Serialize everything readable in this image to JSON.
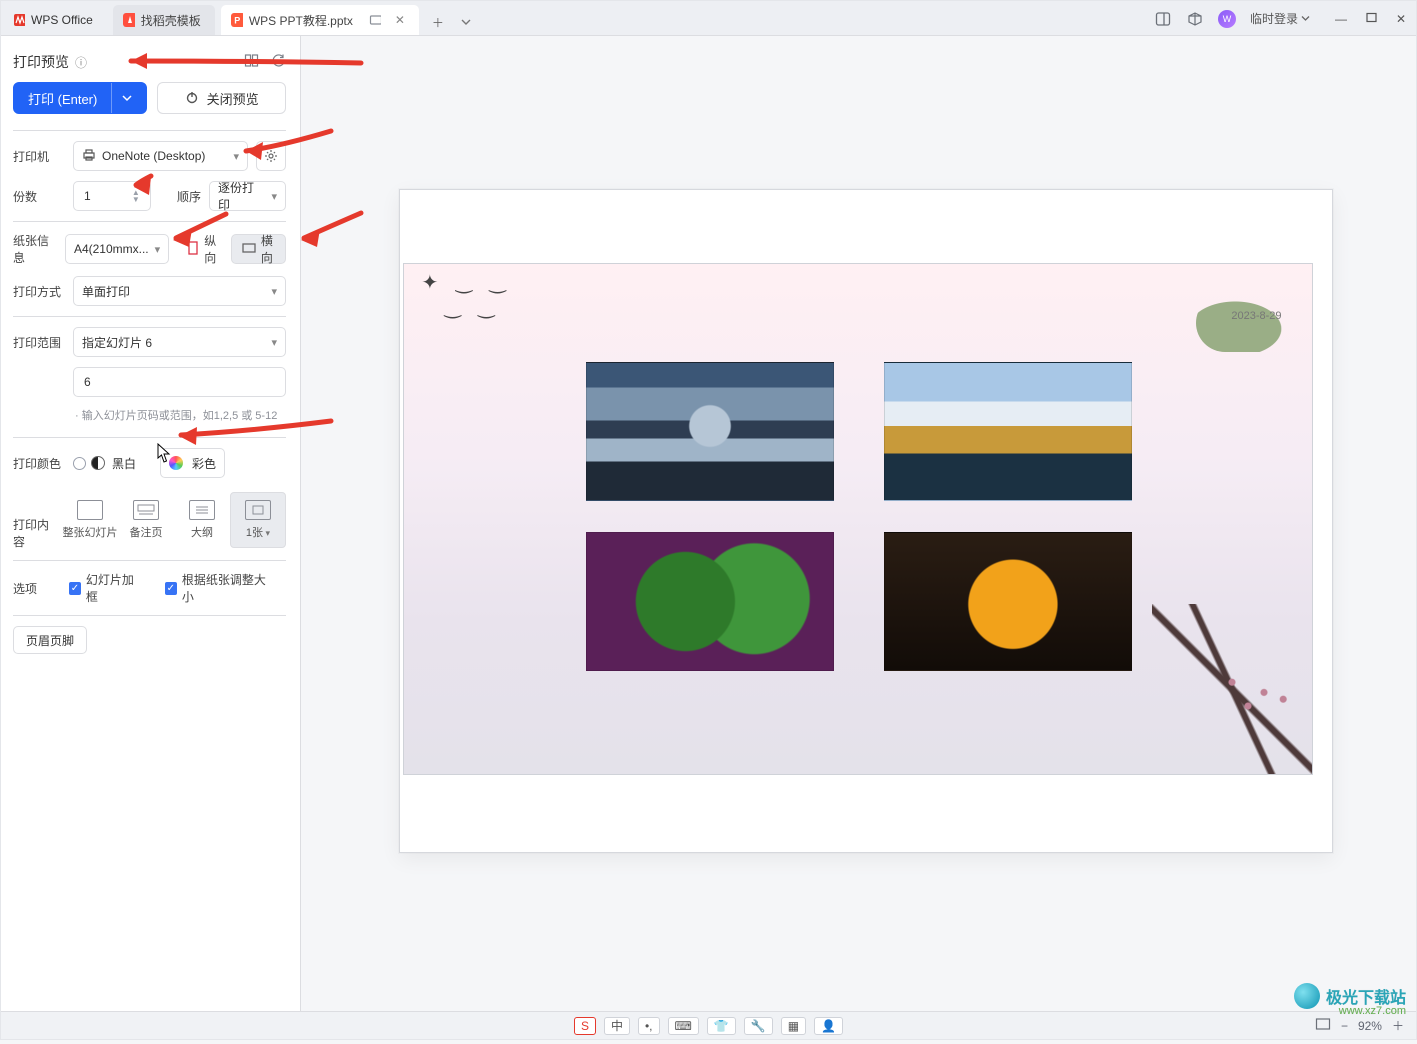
{
  "titlebar": {
    "app_name": "WPS Office",
    "tab_home": "找稻壳模板",
    "tab_doc": "WPS PPT教程.pptx",
    "login_label": "临时登录"
  },
  "panel": {
    "title": "打印预览",
    "print_btn": "打印 (Enter)",
    "close_preview_btn": "关闭预览"
  },
  "printer": {
    "label": "打印机",
    "value": "OneNote (Desktop)"
  },
  "copies": {
    "label": "份数",
    "value": "1",
    "order_label": "顺序",
    "order_value": "逐份打印"
  },
  "paper": {
    "label": "纸张信息",
    "size": "A4(210mmx...",
    "portrait": "纵向",
    "landscape": "横向"
  },
  "mode": {
    "label": "打印方式",
    "value": "单面打印"
  },
  "range": {
    "label": "打印范围",
    "value": "指定幻灯片 6",
    "input": "6",
    "hint": "· 输入幻灯片页码或范围，如1,2,5 或 5-12"
  },
  "color": {
    "label": "打印颜色",
    "bw": "黑白",
    "color": "彩色"
  },
  "content": {
    "label": "打印内容",
    "t1": "整张幻灯片",
    "t2": "备注页",
    "t3": "大纲",
    "t4": "1张"
  },
  "options": {
    "label": "选项",
    "c1": "幻灯片加框",
    "c2": "根据纸张调整大小"
  },
  "footer_btn": "页眉页脚",
  "slide": {
    "date": "2023-8-29"
  },
  "statusbar": {
    "ime": "中",
    "zoom": "92%"
  },
  "watermark": {
    "brand": "极光下载站",
    "url": "www.xz7.com"
  }
}
